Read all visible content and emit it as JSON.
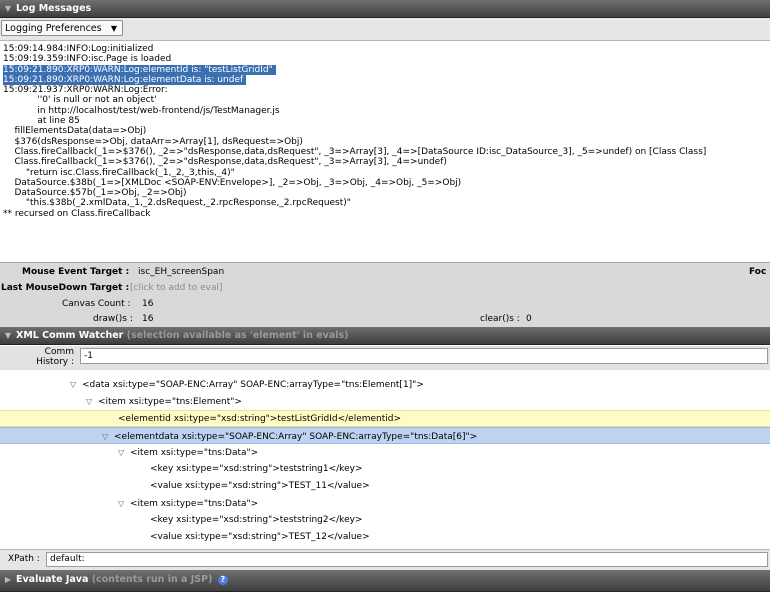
{
  "log_panel": {
    "title": "Log Messages",
    "prefs_button": "Logging Preferences",
    "lines": [
      "15:09:14.984:INFO:Log:initialized",
      "15:09:19.359:INFO:isc.Page is loaded",
      "15:09:21.890:XRP0:WARN:Log:elementId is: \"testListGridId\"",
      "15:09:21.890:XRP0:WARN:Log:elementData is: undef",
      "15:09:21.937:XRP0:WARN:Log:Error:",
      "            ''0' is null or not an object'",
      "            in http://localhost/test/web-frontend/js/TestManager.js",
      "            at line 85",
      "    fillElementsData(data=>Obj)",
      "    $376(dsResponse=>Obj, dataArr=>Array[1], dsRequest=>Obj)",
      "    Class.fireCallback(_1=>$376(), _2=>\"dsResponse,data,dsRequest\", _3=>Array[3], _4=>[DataSource ID:isc_DataSource_3], _5=>undef) on [Class Class]",
      "    Class.fireCallback(_1=>$376(), _2=>\"dsResponse,data,dsRequest\", _3=>Array[3], _4=>undef)",
      "        \"return isc.Class.fireCallback(_1,_2,_3,this,_4)\"",
      "    DataSource.$38b(_1=>[XMLDoc <SOAP-ENV:Envelope>], _2=>Obj, _3=>Obj, _4=>Obj, _5=>Obj)",
      "    DataSource.$57b(_1=>Obj, _2=>Obj)",
      "        \"this.$38b(_2.xmlData,_1,_2.dsRequest,_2.rpcResponse,_2.rpcRequest)\"",
      "** recursed on Class.fireCallback"
    ]
  },
  "stats": {
    "mouse_event_label": "Mouse Event Target :",
    "mouse_event_value": "isc_EH_screenSpan",
    "focus_label": "Foc",
    "last_mousedown_label": "Last MouseDown Target :",
    "last_mousedown_value": "[click to add to eval]",
    "canvas_count_label": "Canvas Count :",
    "canvas_count_value": "16",
    "draws_label": "draw()s :",
    "draws_value": "16",
    "clears_label": "clear()s :",
    "clears_value": "0"
  },
  "xml_panel": {
    "title": "XML Comm Watcher",
    "subtitle": "(selection available as 'element' in evals)",
    "comm_history_label_1": "Comm",
    "comm_history_label_2": "History :",
    "comm_history_value": "-1",
    "tree": [
      "<data xsi:type=\"SOAP-ENC:Array\" SOAP-ENC:arrayType=\"tns:Element[1]\">",
      "<item xsi:type=\"tns:Element\">",
      "<elementid xsi:type=\"xsd:string\">testListGridId</elementid>",
      "<elementdata xsi:type=\"SOAP-ENC:Array\" SOAP-ENC:arrayType=\"tns:Data[6]\">",
      "<item xsi:type=\"tns:Data\">",
      "<key xsi:type=\"xsd:string\">teststring1</key>",
      "<value xsi:type=\"xsd:string\">TEST_11</value>",
      "<item xsi:type=\"tns:Data\">",
      "<key xsi:type=\"xsd:string\">teststring2</key>",
      "<value xsi:type=\"xsd:string\">TEST_12</value>"
    ],
    "xpath_label": "XPath :",
    "xpath_value": "default:"
  },
  "eval_panel": {
    "title": "Evaluate Java",
    "subtitle": "(contents run in a JSP)",
    "help_icon": "?"
  }
}
